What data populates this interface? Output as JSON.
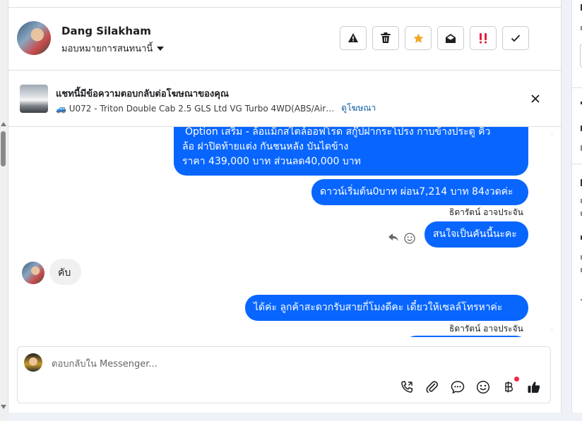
{
  "contact": {
    "name": "Dang Silakham",
    "assign_label": "มอบหมายการสนทนานี้"
  },
  "header_actions": [
    {
      "name": "report-button",
      "icon": "warning-icon"
    },
    {
      "name": "delete-button",
      "icon": "trash-icon"
    },
    {
      "name": "star-button",
      "icon": "star-icon",
      "color": "#f5a623"
    },
    {
      "name": "mark-unread-button",
      "icon": "envelope-open-icon"
    },
    {
      "name": "spam-button",
      "icon": "priority-icon",
      "color": "#e41e3f"
    },
    {
      "name": "done-button",
      "icon": "check-icon"
    }
  ],
  "ad": {
    "title": "แชทนี้มีข้อความตอบกลับต่อโฆษณาของคุณ",
    "product": "🚙 U072 - Triton Double Cab 2.5 GLS Ltd VG Turbo 4WD(ABS/Air…",
    "link": "ดูโฆษณา"
  },
  "messages": {
    "m1": {
      "line1": "Option เสริม - ล้อแม็กสไตล์ออฟโรด สกู๊ปฝากระโปรง กาบข้างประตู คิ้ว",
      "line2": "ล้อ ฝาปิดท้ายแต่ง กันชนหลัง บันไดข้าง",
      "line3": "ราคา 439,000 บาท ส่วนลด40,000 บาท"
    },
    "m2": "ดาวน์เริ่มต้น0บาท ผ่อน7,214 บาท 84งวดค่ะ",
    "m2_sender": "ธิดารัตน์ อาจประจัน",
    "m3": "สนใจเป็นคันนี้นะคะ",
    "m4": "คับ",
    "m5": "ได้ค่ะ ลูกค้าสะดวกรับสายกี่โมงดีคะ เดี๋ยวให้เซลล์โทรหาค่ะ",
    "m5_sender": "ธิดารัตน์ อาจประจัน"
  },
  "composer": {
    "placeholder": "ตอบกลับใน Messenger..."
  },
  "composer_tools": [
    "call-icon",
    "attach-icon",
    "chat-bubble-icon",
    "emoji-icon",
    "baht-icon",
    "thumbs-up-icon"
  ],
  "colors": {
    "outgoing_bubble": "#0866ff",
    "incoming_bubble": "#f0f0f0",
    "link": "#0a5aa8",
    "star": "#f5a623",
    "notification_dot": "#f02849"
  }
}
